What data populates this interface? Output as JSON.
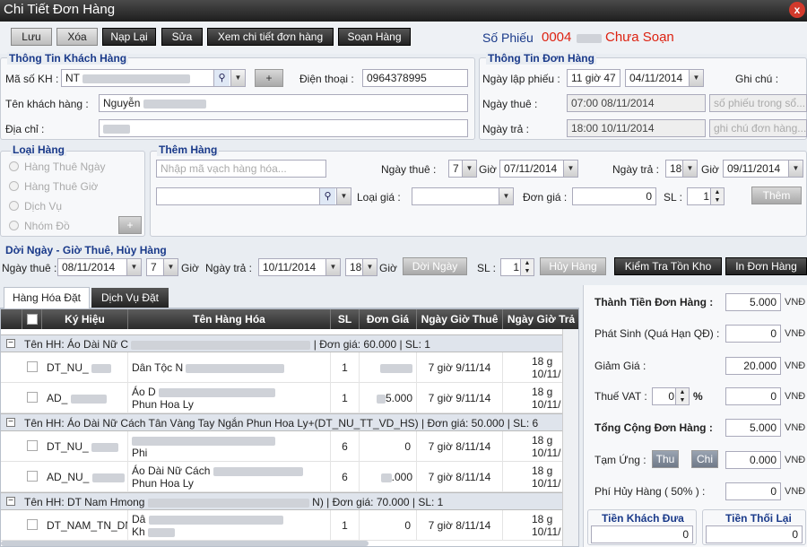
{
  "window": {
    "title": "Chi Tiết Đơn Hàng",
    "close": "x"
  },
  "toolbar": {
    "save": "Lưu",
    "delete": "Xóa",
    "reload": "Nạp Lại",
    "edit": "Sửa",
    "view_detail": "Xem chi tiết đơn hàng",
    "compose": "Soạn Hàng",
    "so_phieu_label": "Số Phiếu",
    "so_phieu_value": "0004",
    "status": "Chưa Soạn"
  },
  "customer": {
    "title": "Thông Tin Khách Hàng",
    "code_label": "Mã số KH :",
    "code_value": "NT",
    "phone_label": "Điện thoại :",
    "phone_value": "0964378995",
    "name_label": "Tên khách hàng :",
    "name_value": "Nguyễn",
    "address_label": "Địa chỉ :",
    "add_btn": "+"
  },
  "order": {
    "title": "Thông Tin Đơn Hàng",
    "date_label": "Ngày lập phiếu :",
    "time_value": "11 giờ 47",
    "date_value": "04/11/2014",
    "note_label": "Ghi chú :",
    "rent_label": "Ngày thuê :",
    "rent_value": "07:00 08/11/2014",
    "so_phieu_ph": "số phiếu trong sổ...",
    "return_label": "Ngày trả :",
    "return_value": "18:00 10/11/2014",
    "note_ph": "ghi chú đơn hàng..."
  },
  "type_panel": {
    "title": "Loại Hàng",
    "options": [
      "Hàng Thuê Ngày",
      "Hàng Thuê Giờ",
      "Dịch Vụ",
      "Nhóm Đồ"
    ],
    "add_btn": "+"
  },
  "add_item": {
    "title": "Thêm Hàng",
    "barcode_ph": "Nhập mã vạch hàng hóa...",
    "rent_label": "Ngày thuê :",
    "rent_hour": "7",
    "hour_label": "Giờ",
    "rent_date": "07/11/2014",
    "return_label": "Ngày trả :",
    "return_hour": "18",
    "return_date": "09/11/2014",
    "price_type_label": "Loại giá :",
    "unit_price_label": "Đơn giá :",
    "unit_price_value": "0",
    "qty_label": "SL :",
    "qty_value": "1",
    "add_btn": "Thêm"
  },
  "reschedule": {
    "title": "Dời Ngày - Giờ Thuê, Hủy Hàng",
    "rent_label": "Ngày thuê :",
    "rent_date": "08/11/2014",
    "rent_hour": "7",
    "hour_label": "Giờ",
    "return_label": "Ngày trả :",
    "return_date": "10/11/2014",
    "return_hour": "18",
    "move_btn": "Dời Ngày",
    "qty_label": "SL :",
    "qty_value": "1",
    "cancel_btn": "Hủy Hàng",
    "stock_btn": "Kiểm Tra Tồn Kho",
    "print_btn": "In Đơn Hàng"
  },
  "tabs": [
    "Hàng Hóa Đặt",
    "Dịch Vụ Đặt"
  ],
  "grid": {
    "headers": [
      "Ký Hiệu",
      "Tên Hàng Hóa",
      "SL",
      "Đơn Giá",
      "Ngày Giờ Thuê",
      "Ngày Giờ Trả"
    ],
    "groups": [
      {
        "text": "Tên HH: Áo Dài Nữ C",
        "tail": "| Đơn giá: 60.000 | SL: 1",
        "rows": [
          {
            "code": "DT_NU_",
            "name": "Dân Tộc N",
            "qty": "1",
            "price": "",
            "rent": "7 giờ 9/11/14",
            "ret1": "18 g",
            "ret2": "10/11/"
          },
          {
            "code": "AD_",
            "name": "Áo D",
            "name2": "Phun Hoa Ly",
            "qty": "1",
            "price": "5.000",
            "rent": "7 giờ 9/11/14",
            "ret1": "18 g",
            "ret2": "10/11/"
          }
        ]
      },
      {
        "text": "Tên HH: Áo Dài Nữ Cách Tân Vàng Tay Ngắn Phun Hoa Ly+(DT_NU_TT_VD_HS) | Đơn giá: 50.000 | SL: 6",
        "tail": "",
        "rows": [
          {
            "code": "DT_NU_",
            "name": "",
            "name2": "Phi",
            "qty": "6",
            "price": "0",
            "rent": "7 giờ 8/11/14",
            "ret1": "18 g",
            "ret2": "10/11/"
          },
          {
            "code": "AD_NU_",
            "name": "Áo Dài Nữ Cách",
            "name2": "Phun Hoa Ly",
            "qty": "6",
            "price": ".000",
            "rent": "7 giờ 8/11/14",
            "ret1": "18 g",
            "ret2": "10/11/"
          }
        ]
      },
      {
        "text": "Tên HH: DT Nam Hmong",
        "tail": "N) | Đơn giá: 70.000 | SL: 1",
        "rows": [
          {
            "code": "DT_NAM_TN_DN",
            "name": "Dâ",
            "name2": "Kh",
            "qty": "1",
            "price": "0",
            "rent": "7 giờ 8/11/14",
            "ret1": "18 g",
            "ret2": "10/11/"
          }
        ]
      }
    ]
  },
  "summary": {
    "total_label": "Thành Tiền Đơn Hàng :",
    "total_value": "5.000",
    "extra_label": "Phát Sinh (Quá Hạn QĐ) :",
    "extra_value": "0",
    "discount_label": "Giảm Giá :",
    "discount_value": "20.000",
    "vat_label": "Thuế VAT :",
    "vat_pct": "0",
    "vat_unit": "%",
    "vat_value": "0",
    "grand_label": "Tổng Cộng Đơn Hàng :",
    "grand_value": "5.000",
    "advance_label": "Tạm Ứng :",
    "thu_btn": "Thu",
    "chi_btn": "Chi",
    "advance_value": "0.000",
    "cancel_fee_label": "Phí Hủy Hàng ( 50% ) :",
    "cancel_fee_value": "0",
    "cust_pay_label": "Tiền Khách Đưa",
    "cust_pay_value": "0",
    "change_label": "Tiền Thối Lại",
    "change_value": "0",
    "currency": "VNĐ"
  }
}
